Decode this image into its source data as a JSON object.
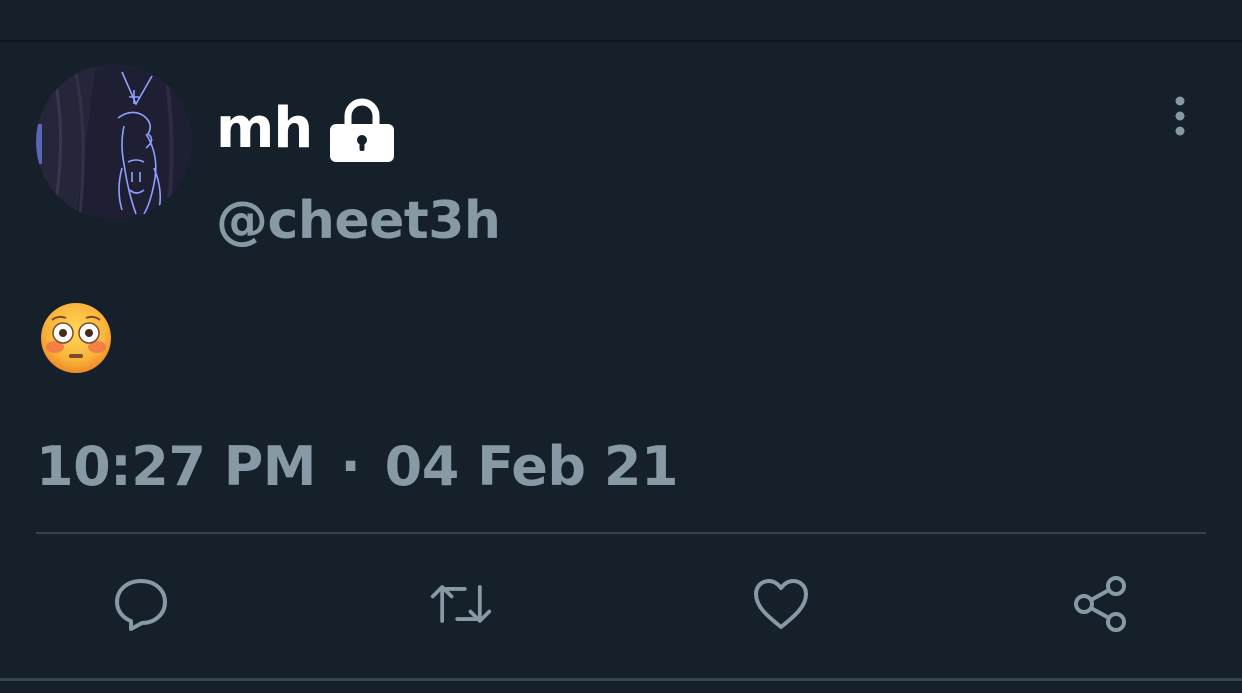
{
  "tweet": {
    "author": {
      "display_name": "mh",
      "handle": "@cheet3h",
      "protected_icon": "lock-icon",
      "avatar": "avatar"
    },
    "text": "😳",
    "time": "10:27 PM",
    "separator": "·",
    "date": "04 Feb 21",
    "menu_icon": "more-vertical-icon"
  },
  "actions": [
    {
      "name": "reply",
      "icon": "reply-icon"
    },
    {
      "name": "retweet",
      "icon": "retweet-icon"
    },
    {
      "name": "like",
      "icon": "heart-icon"
    },
    {
      "name": "share",
      "icon": "share-icon"
    }
  ],
  "colors": {
    "background": "#15202b",
    "primary_text": "#ffffff",
    "secondary_text": "#8899a6",
    "divider": "#38444d"
  }
}
